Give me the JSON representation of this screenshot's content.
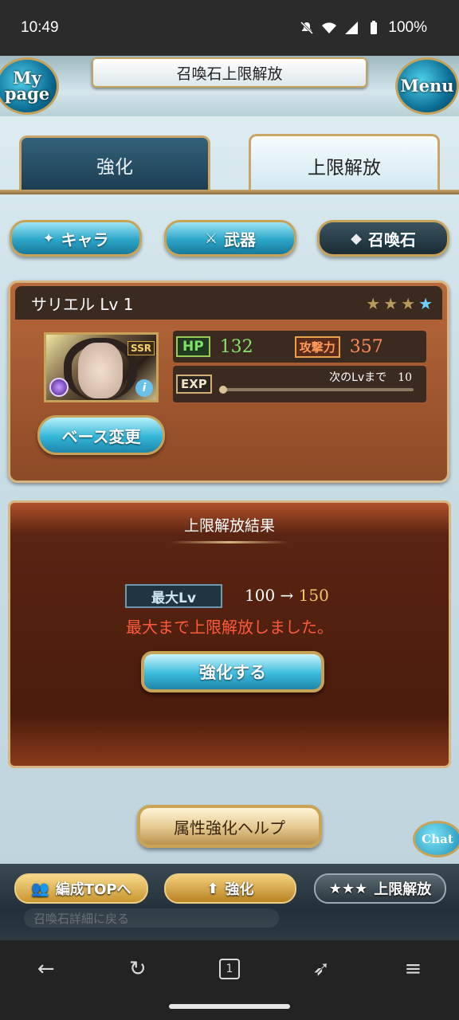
{
  "status": {
    "time": "10:49",
    "battery": "100%",
    "icons": [
      "mute-icon",
      "wifi-icon",
      "signal-icon",
      "battery-icon"
    ]
  },
  "header": {
    "title": "召喚石上限解放",
    "mypage_label": "My page",
    "menu_label": "Menu"
  },
  "tabs": [
    {
      "label": "強化",
      "active": false
    },
    {
      "label": "上限解放",
      "active": true
    }
  ],
  "categories": [
    {
      "label": "キャラ",
      "icon": "chara-icon",
      "active": false
    },
    {
      "label": "武器",
      "icon": "weapon-icon",
      "active": false
    },
    {
      "label": "召喚石",
      "icon": "summon-icon",
      "active": true
    }
  ],
  "summon": {
    "name_level": "サリエル Lv 1",
    "rarity": "SSR",
    "uncap_stars_filled": 3,
    "uncap_stars_total": 4,
    "hp_label": "HP",
    "hp": "132",
    "atk_label": "攻撃力",
    "atk": "357",
    "exp_label": "EXP",
    "next_level_label": "次のLvまで",
    "next_level_value": "10",
    "exp_progress": 0.0,
    "element": "dark",
    "change_base_label": "ベース変更"
  },
  "result": {
    "title": "上限解放結果",
    "max_lv_label": "最大Lv",
    "from_lv": "100",
    "arrow": "→",
    "to_lv": "150",
    "message": "最大まで上限解放しました。",
    "strengthen_label": "強化する"
  },
  "help_label": "属性強化ヘルプ",
  "chat_label": "Chat",
  "bottom": {
    "party_top": "編成TOPへ",
    "strengthen": "強化",
    "limit_break": "上限解放",
    "ghost_text": "召喚石詳細に戻る"
  },
  "colors": {
    "accent_blue": "#2aa6c9",
    "gold_frame": "#c7a35a",
    "hp_green": "#8ce06d",
    "atk_orange": "#ff8a5a",
    "warning_red": "#ff5a3a"
  }
}
